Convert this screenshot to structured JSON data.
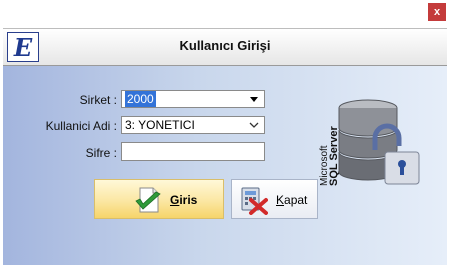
{
  "window": {
    "close_label": "x"
  },
  "header": {
    "title": "Kullanıcı Girişi",
    "logo_letter": "E"
  },
  "form": {
    "company_label": "Sirket :",
    "company_value": "2000",
    "user_label": "Kullanici Adi :",
    "user_value": "3: YONETICI",
    "password_label": "Sifre :",
    "password_value": ""
  },
  "buttons": {
    "login_first": "G",
    "login_rest": "iris",
    "close_first": "K",
    "close_rest": "apat"
  },
  "sql_graphic": {
    "line1": "Microsoft",
    "line2": "SQL Server"
  },
  "colors": {
    "accent_blue": "#3373d8",
    "login_button": "#fbe7a3",
    "close_red": "#c43b3b",
    "db_gray": "#7a7d84"
  }
}
